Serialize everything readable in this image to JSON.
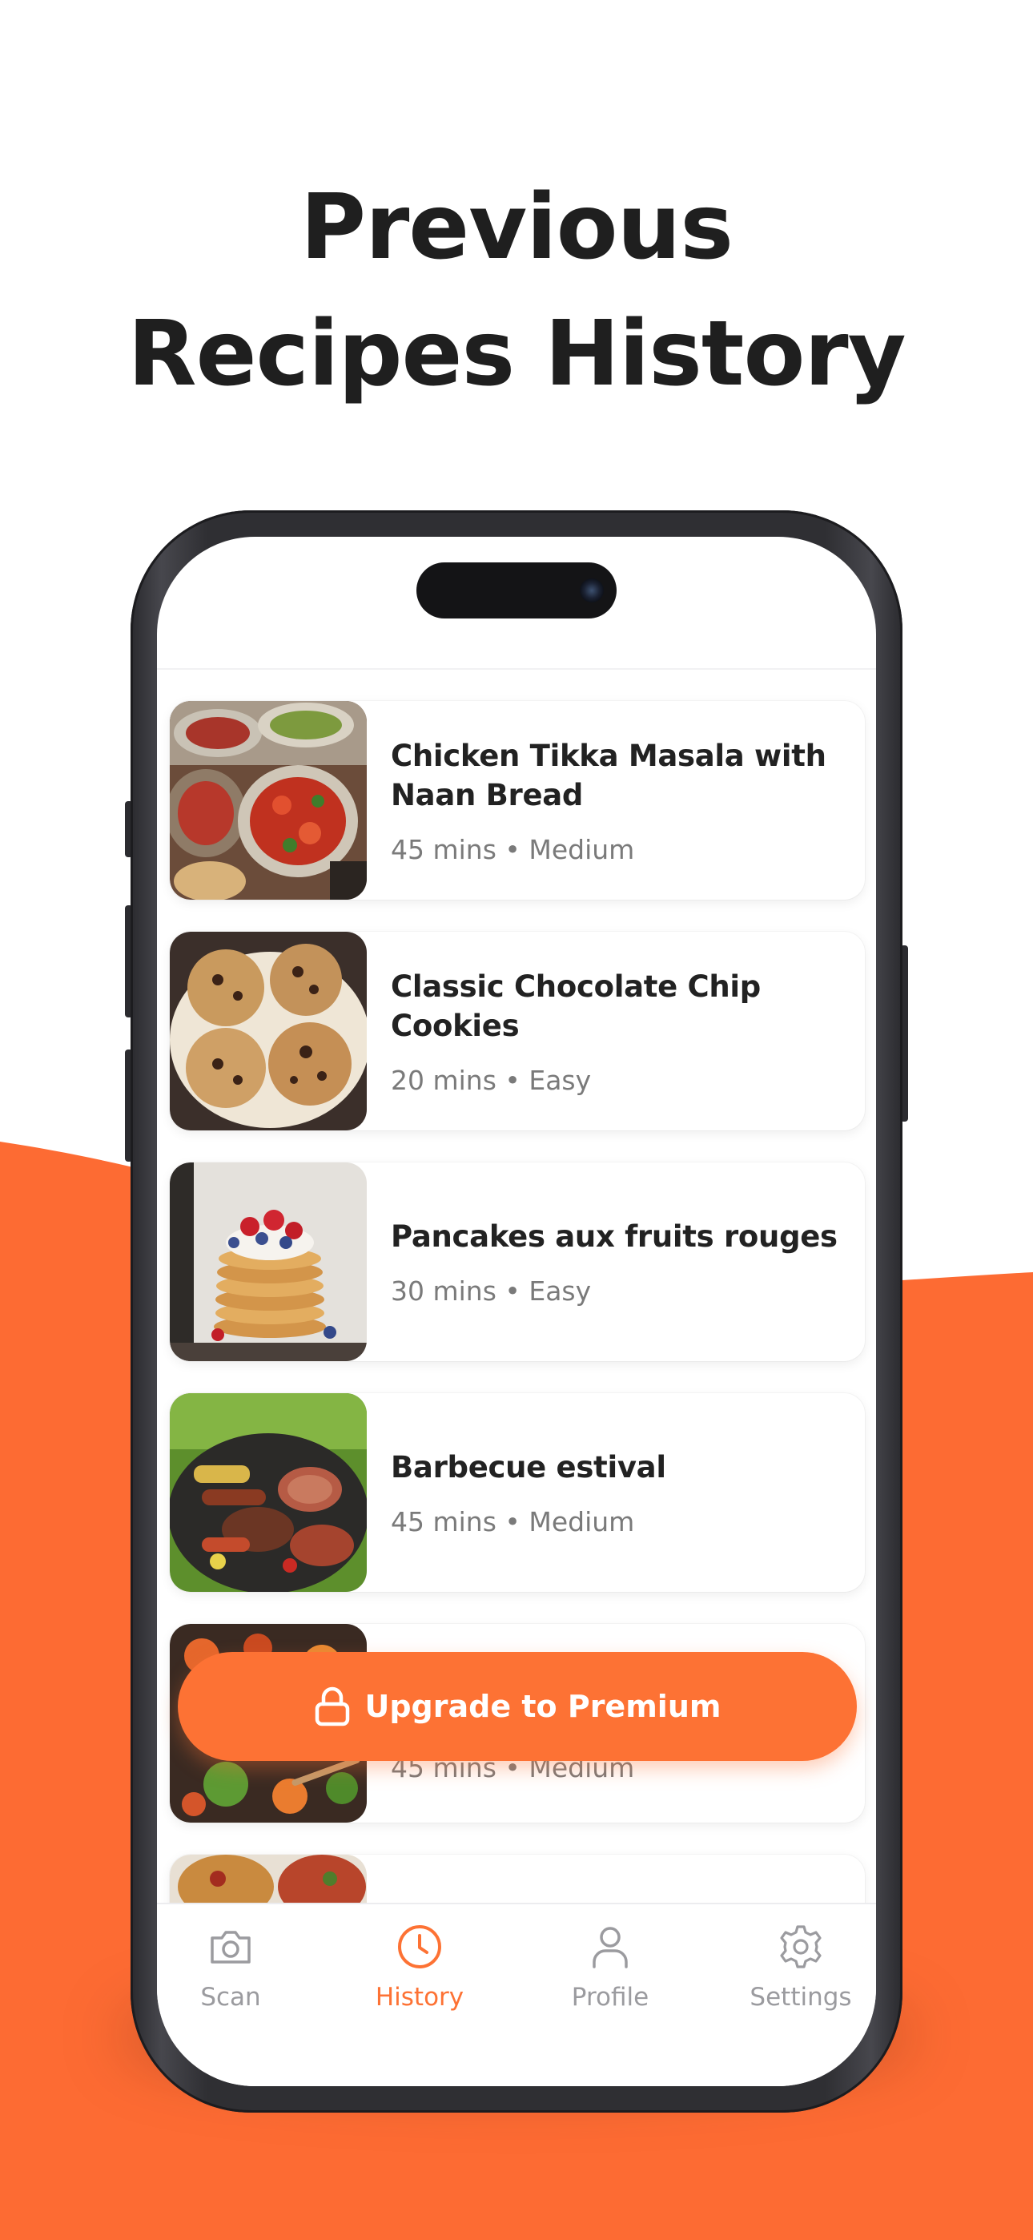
{
  "headline": {
    "line1": "Previous",
    "line2": "Recipes History"
  },
  "colors": {
    "accent": "#fd7234",
    "title_text": "#1f1f1f",
    "muted_text": "#7a7a7a",
    "tab_inactive": "#9b9b9f"
  },
  "recipes": [
    {
      "title": "Chicken Tikka Masala with Naan Bread",
      "meta": "45 mins • Medium",
      "thumb": "chicken-tikka-photo"
    },
    {
      "title": "Classic Chocolate Chip Cookies",
      "meta": "20 mins • Easy",
      "thumb": "cookies-photo"
    },
    {
      "title": "Pancakes aux fruits rouges",
      "meta": "30 mins • Easy",
      "thumb": "pancakes-photo"
    },
    {
      "title": "Barbecue estival",
      "meta": "45 mins • Medium",
      "thumb": "barbecue-photo"
    },
    {
      "title": "",
      "meta": "45 mins • Medium",
      "thumb": "salad-photo"
    },
    {
      "title": "",
      "meta": "",
      "thumb": "pasta-photo"
    }
  ],
  "upgrade": {
    "label": "Upgrade to Premium",
    "icon": "lock-icon"
  },
  "tabs": [
    {
      "label": "Scan",
      "icon": "camera-icon",
      "active": false
    },
    {
      "label": "History",
      "icon": "clock-icon",
      "active": true
    },
    {
      "label": "Profile",
      "icon": "person-icon",
      "active": false
    },
    {
      "label": "Settings",
      "icon": "gear-icon",
      "active": false
    }
  ]
}
